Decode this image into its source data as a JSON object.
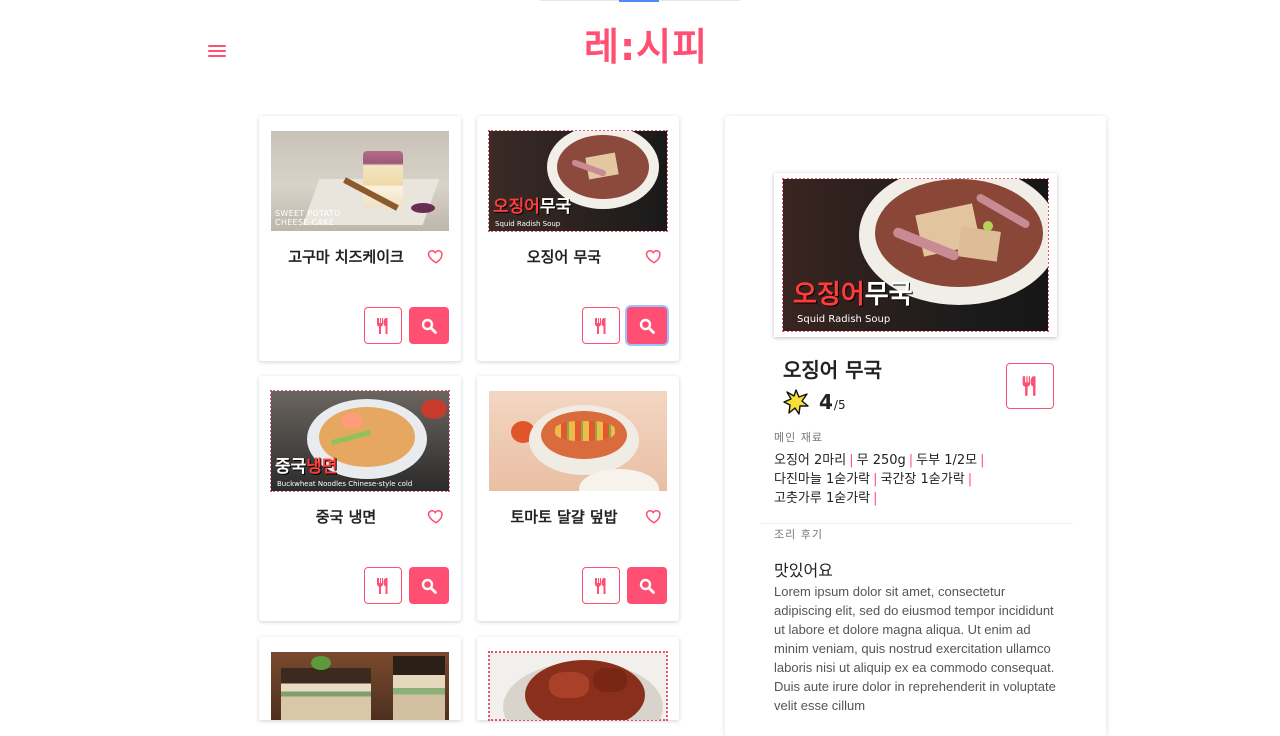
{
  "app": {
    "logo_main": "레",
    "logo_rest": ":시피"
  },
  "header": {
    "menu_icon": "hamburger-icon"
  },
  "cards": [
    {
      "title": "고구마 치즈케이크",
      "thumb_caption_1": "SWEET POTATO",
      "thumb_caption_2": "CHEESE CAKE"
    },
    {
      "title": "오징어 무국",
      "thumb_title_a": "오징어",
      "thumb_title_b": "무국",
      "thumb_sub": "Squid Radish Soup"
    },
    {
      "title": "중국 냉면",
      "thumb_title_a": "중국",
      "thumb_title_b": "냉면",
      "thumb_sub": "Buckwheat Noodles Chinese-style cold"
    },
    {
      "title": "토마토 달걀 덮밥"
    },
    {
      "title": ""
    },
    {
      "title": ""
    }
  ],
  "detail": {
    "title": "오징어 무국",
    "hero_title_a": "오징어",
    "hero_title_b": "무국",
    "hero_sub": "Squid Radish Soup",
    "rating": "4",
    "rating_max": "/5",
    "ingredients_label": "메인 재료",
    "ingredients": [
      "오징어 2마리",
      "무 250g",
      "두부 1/2모",
      "다진마늘 1숟가락",
      "국간장 1숟가락",
      "고춧가루 1숟가락"
    ],
    "review_label": "조리 후기",
    "review_title": "맛있어요",
    "review_body": "Lorem ipsum dolor sit amet, consectetur adipiscing elit, sed do eiusmod tempor incididunt ut labore et dolore magna aliqua. Ut enim ad minim veniam, quis nostrud exercitation ullamco laboris nisi ut aliquip ex ea commodo consequat. Duis aute irure dolor in reprehenderit in voluptate velit esse cillum"
  },
  "colors": {
    "accent": "#ff4f72",
    "star": "#f5e03a"
  }
}
